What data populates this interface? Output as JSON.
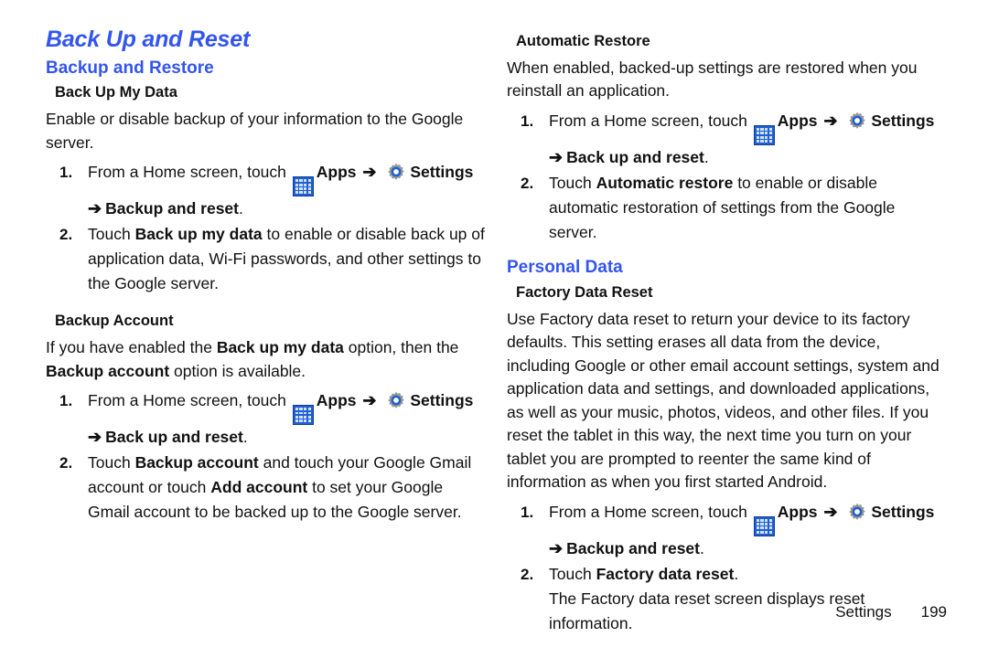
{
  "chapter_title": "Back Up and Reset",
  "colors": {
    "heading_blue": "#3355ee",
    "text_black": "#111111",
    "apps_icon_blue": "#1f5fd0",
    "gear_ring_blue": "#1f5fd0"
  },
  "icons": {
    "apps": "apps-grid-icon",
    "settings": "settings-gear-icon",
    "arrow": "➔"
  },
  "left_column": {
    "section_title": "Backup and Restore",
    "backup_my_data": {
      "heading": "Back Up My Data",
      "intro": "Enable or disable backup of your information to the Google server.",
      "steps": [
        {
          "num": "1.",
          "pre": "From a Home screen, touch",
          "apps_label": "Apps",
          "arrow": "➔",
          "settings_label": "Settings",
          "cont_arrow": "➔",
          "cont_bold": "Backup and reset",
          "cont_tail": "."
        },
        {
          "num": "2.",
          "text_pre": "Touch ",
          "bold": "Back up my data",
          "text_post": " to enable or disable back up of application data, Wi-Fi passwords, and other settings to the Google server."
        }
      ]
    },
    "backup_account": {
      "heading": "Backup Account",
      "intro_pre": "If you have enabled the ",
      "intro_bold1": "Back up my data",
      "intro_mid": " option, then the ",
      "intro_bold2": "Backup account",
      "intro_post": " option is available.",
      "steps": [
        {
          "num": "1.",
          "pre": "From a Home screen, touch",
          "apps_label": "Apps",
          "arrow": "➔",
          "settings_label": "Settings",
          "cont_arrow": "➔",
          "cont_bold": "Back up and reset",
          "cont_tail": "."
        },
        {
          "num": "2.",
          "text_pre": "Touch ",
          "bold1": "Backup account",
          "text_mid": " and touch your Google Gmail account or touch ",
          "bold2": "Add account",
          "text_post": " to set your Google Gmail account to be backed up to the Google server."
        }
      ]
    }
  },
  "right_column": {
    "automatic_restore": {
      "heading": "Automatic Restore",
      "intro": "When enabled, backed-up settings are restored when you reinstall an application.",
      "steps": [
        {
          "num": "1.",
          "pre": "From a Home screen, touch",
          "apps_label": "Apps",
          "arrow": "➔",
          "settings_label": "Settings",
          "cont_arrow": "➔",
          "cont_bold": "Back up and reset",
          "cont_tail": "."
        },
        {
          "num": "2.",
          "text_pre": "Touch ",
          "bold": "Automatic restore",
          "text_post": " to enable or disable automatic restoration of settings from the Google server."
        }
      ]
    },
    "section_title": "Personal Data",
    "factory_data_reset": {
      "heading": "Factory Data Reset",
      "intro": "Use Factory data reset to return your device to its factory defaults. This setting erases all data from the device, including Google or other email account settings, system and application data and settings, and downloaded applications, as well as your music, photos, videos, and other files. If you reset the tablet in this way, the next time you turn on your tablet you are prompted to reenter the same kind of information as when you first started Android.",
      "steps": [
        {
          "num": "1.",
          "pre": "From a Home screen, touch",
          "apps_label": "Apps",
          "arrow": "➔",
          "settings_label": "Settings",
          "cont_arrow": "➔",
          "cont_bold": "Backup and reset",
          "cont_tail": "."
        },
        {
          "num": "2.",
          "text_pre": "Touch ",
          "bold": "Factory data reset",
          "text_post": ".",
          "note": "The Factory data reset screen displays reset information."
        }
      ]
    }
  },
  "footer": {
    "label": "Settings",
    "page_number": "199"
  }
}
